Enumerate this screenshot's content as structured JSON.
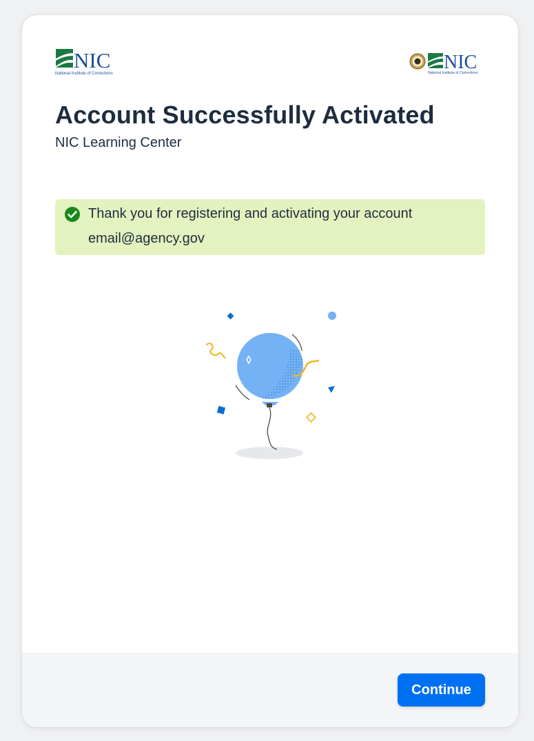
{
  "header": {
    "logo_left": {
      "name": "NIC",
      "tagline": "National Institute of Corrections"
    },
    "logo_right": {
      "name": "NIC",
      "tagline": "National Institute of Corrections"
    },
    "title": "Account Successfully Activated",
    "subtitle": "NIC Learning Center"
  },
  "message": {
    "type": "success",
    "icon": "check-circle-icon",
    "line1": "Thank you for registering and activating your account",
    "line2": "email@agency.gov"
  },
  "illustration": {
    "icon": "balloon-celebration-illustration"
  },
  "footer": {
    "continue_label": "Continue"
  },
  "colors": {
    "accent": "#0070f2",
    "success": "#188918",
    "success_bg": "#e4f2bf",
    "text": "#1d2d3e",
    "nic_green": "#1a7a44",
    "nic_blue": "#1c4e9c"
  }
}
